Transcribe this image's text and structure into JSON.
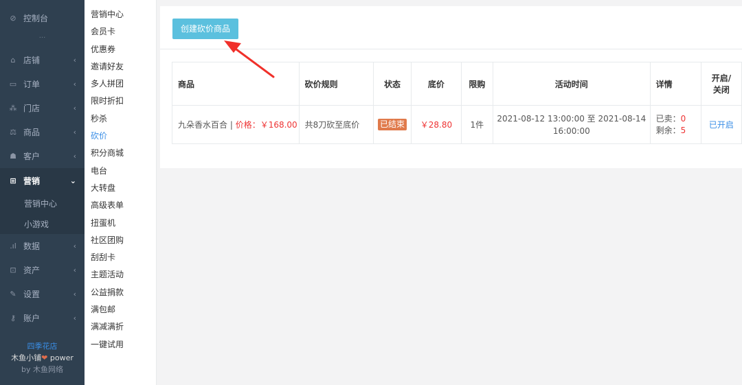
{
  "sidebar": {
    "dashboard": "控制台",
    "items": [
      {
        "label": "店铺"
      },
      {
        "label": "订单"
      },
      {
        "label": "门店"
      },
      {
        "label": "商品"
      },
      {
        "label": "客户"
      },
      {
        "label": "营销"
      },
      {
        "label": "数据"
      },
      {
        "label": "资产"
      },
      {
        "label": "设置"
      },
      {
        "label": "账户"
      }
    ],
    "sub_items": [
      {
        "label": "营销中心"
      },
      {
        "label": "小游戏"
      }
    ],
    "footer": {
      "shop_name": "四季花店",
      "powered_prefix": "木鱼小铺",
      "powered_suffix": "power",
      "by_line": "by 木鱼网络"
    }
  },
  "submenu": {
    "items": [
      "营销中心",
      "会员卡",
      "优惠券",
      "邀请好友",
      "多人拼团",
      "限时折扣",
      "秒杀",
      "砍价",
      "积分商城",
      "电台",
      "大转盘",
      "高级表单",
      "扭蛋机",
      "社区团购",
      "刮刮卡",
      "主题活动",
      "公益捐款",
      "满包邮",
      "满减满折",
      "一键试用"
    ],
    "current_index": 7
  },
  "main": {
    "create_button": "创建砍价商品",
    "table": {
      "headers": {
        "goods": "商品",
        "rule": "砍价规则",
        "status": "状态",
        "floor_price": "底价",
        "limit": "限购",
        "time": "活动时间",
        "detail": "详情",
        "toggle_line1": "开启/",
        "toggle_line2": "关闭"
      },
      "rows": [
        {
          "goods_name": "九朵香水百合 | ",
          "goods_price": "价格：￥168.00",
          "rule": "共8刀砍至底价",
          "status": "已结束",
          "floor_price": "￥28.80",
          "limit": "1件",
          "time_line1": "2021-08-12 13:00:00 至 2021-08-14",
          "time_line2": "16:00:00",
          "sold_label": "已卖：",
          "sold_value": "0",
          "remain_label": "剩余：",
          "remain_value": "5",
          "toggle": "已开启"
        }
      ]
    }
  },
  "colors": {
    "sidebar_bg": "#2f4050",
    "button_bg": "#5bc0de",
    "price_red": "#e33",
    "status_badge": "#e07a4b",
    "link_blue": "#3a8ee6",
    "arrow_red": "#f0302a"
  },
  "icons": [
    "dashboard-icon",
    "shop-icon",
    "order-icon",
    "store-icon",
    "goods-icon",
    "customer-icon",
    "gift-icon",
    "chart-icon",
    "asset-icon",
    "wrench-icon",
    "key-icon",
    "chevron-left-icon",
    "chevron-down-icon",
    "heart-icon",
    "arrow-annotation"
  ]
}
